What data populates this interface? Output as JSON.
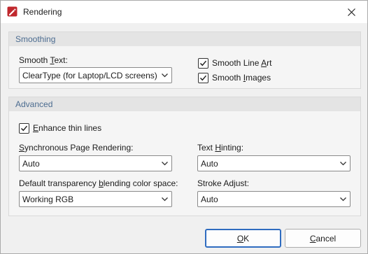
{
  "window": {
    "title": "Rendering",
    "icon": "pdf-pen-icon",
    "accent_color": "#2f6cc0",
    "group_title_color": "#4c6c90"
  },
  "smoothing": {
    "title": "Smoothing",
    "smooth_text_label_pre": "Smooth ",
    "smooth_text_label_key": "T",
    "smooth_text_label_post": "ext:",
    "smooth_text_value": "ClearType (for Laptop/LCD screens)",
    "smooth_line_art": {
      "pre": "Smooth Line ",
      "key": "A",
      "post": "rt",
      "checked": true
    },
    "smooth_images": {
      "pre": "Smooth ",
      "key": "I",
      "post": "mages",
      "checked": true
    }
  },
  "advanced": {
    "title": "Advanced",
    "enhance_thin_lines": {
      "pre": "",
      "key": "E",
      "post": "nhance thin lines",
      "checked": true
    },
    "sync_render": {
      "pre": "",
      "key": "S",
      "post": "ynchronous Page Rendering:",
      "value": "Auto"
    },
    "text_hinting": {
      "pre": "Text ",
      "key": "H",
      "post": "inting:",
      "value": "Auto"
    },
    "blend_space": {
      "pre": "Default transparency ",
      "key": "b",
      "post": "lending color space:",
      "value": "Working RGB"
    },
    "stroke_adjust": {
      "pre": "Stroke Ad",
      "key": "j",
      "post": "ust:",
      "value": "Auto"
    }
  },
  "buttons": {
    "ok": {
      "pre": "",
      "key": "O",
      "post": "K"
    },
    "cancel": {
      "pre": "",
      "key": "C",
      "post": "ancel"
    }
  }
}
